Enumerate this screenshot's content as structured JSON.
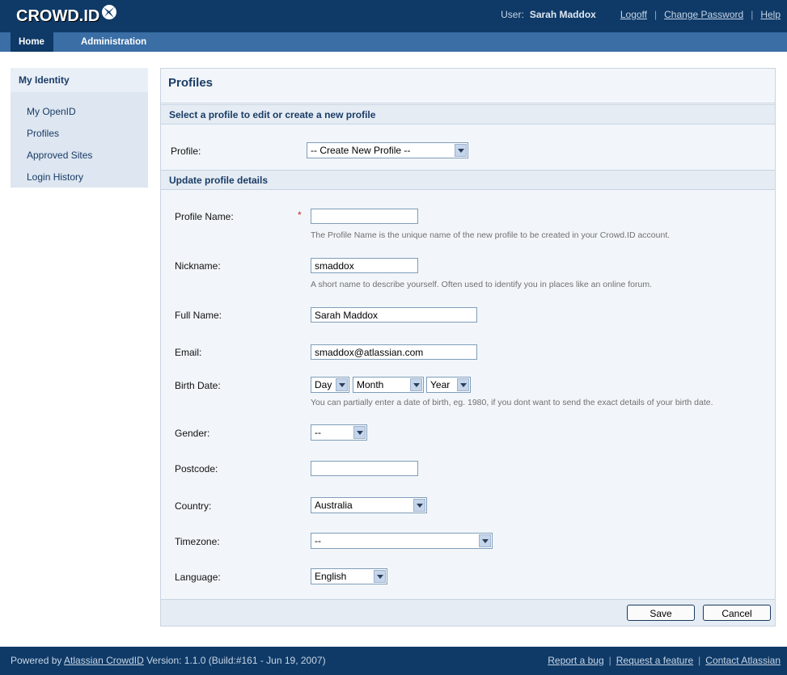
{
  "header": {
    "logo": "CROWD.ID",
    "user_label": "User:",
    "user_name": "Sarah Maddox",
    "links": [
      "Logoff",
      "Change Password",
      "Help"
    ]
  },
  "nav": {
    "tabs": [
      "Home",
      "Administration"
    ]
  },
  "sidebar": {
    "title": "My Identity",
    "items": [
      "My OpenID",
      "Profiles",
      "Approved Sites",
      "Login History"
    ]
  },
  "main": {
    "title": "Profiles",
    "select_section": "Select a profile to edit or create a new profile",
    "profile_label": "Profile:",
    "profile_selected": "-- Create New Profile --",
    "update_section": "Update profile details",
    "fields": {
      "profile_name": {
        "label": "Profile Name:",
        "value": "",
        "required": "*",
        "hint": "The Profile Name is the unique name of the new profile to be created in your Crowd.ID account."
      },
      "nickname": {
        "label": "Nickname:",
        "value": "smaddox",
        "hint": "A short name to describe yourself. Often used to identify you in places like an online forum."
      },
      "full_name": {
        "label": "Full Name:",
        "value": "Sarah Maddox"
      },
      "email": {
        "label": "Email:",
        "value": "smaddox@atlassian.com"
      },
      "birth_date": {
        "label": "Birth Date:",
        "day": "Day",
        "month": "Month",
        "year": "Year",
        "hint": "You can partially enter a date of birth, eg. 1980, if you dont want to send the exact details of your birth date."
      },
      "gender": {
        "label": "Gender:",
        "value": "--"
      },
      "postcode": {
        "label": "Postcode:",
        "value": ""
      },
      "country": {
        "label": "Country:",
        "value": "Australia"
      },
      "timezone": {
        "label": "Timezone:",
        "value": "--"
      },
      "language": {
        "label": "Language:",
        "value": "English"
      }
    },
    "buttons": {
      "save": "Save",
      "cancel": "Cancel"
    }
  },
  "footer": {
    "powered_prefix": "Powered by",
    "powered_link": "Atlassian CrowdID",
    "version": "Version: 1.1.0 (Build:#161 - Jun 19, 2007)",
    "links": [
      "Report a bug",
      "Request a feature",
      "Contact Atlassian"
    ]
  },
  "colors": {
    "header": "#0f3a67",
    "nav": "#3a6ea5",
    "accent_text": "#1a3c66"
  }
}
